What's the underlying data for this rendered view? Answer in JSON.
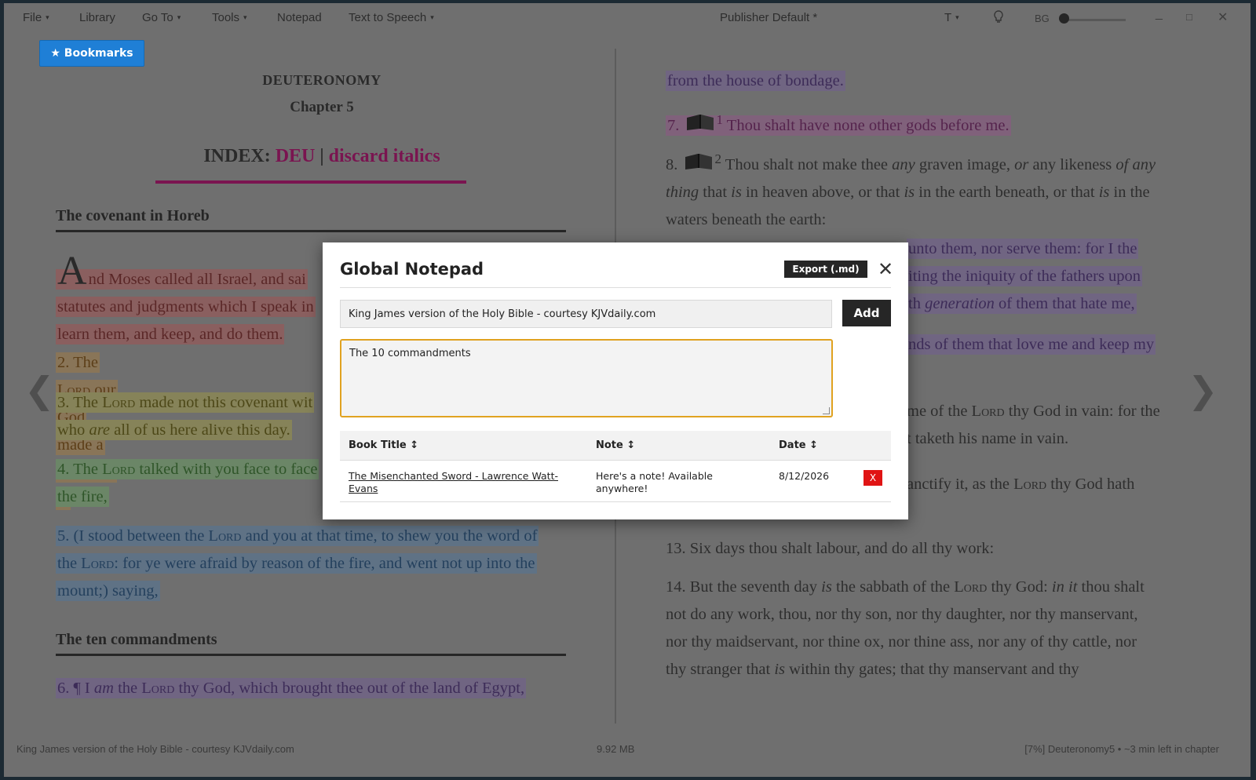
{
  "menu": {
    "file": "File",
    "library": "Library",
    "goto": "Go To",
    "tools": "Tools",
    "notepad": "Notepad",
    "tts": "Text to Speech",
    "caret": "▾"
  },
  "toolbar": {
    "publisher": "Publisher Default *",
    "font_button": "T",
    "bg_label": "BG",
    "minimize": "_",
    "maximize": "□",
    "close": "✕"
  },
  "bookmarks_label": "★ Bookmarks",
  "book": {
    "title": "DEUTERONOMY",
    "chapter": "Chapter 5",
    "index_prefix": "INDEX:",
    "index_deu": "DEU",
    "index_sep": " | ",
    "index_discard": "discard italics",
    "section1": "The covenant in Horeb",
    "section2": "The ten commandments",
    "accent_color": "#7a1450"
  },
  "left_verses": {
    "v1_cap": "A",
    "v1_rest": "nd Moses called all Israel, and sai",
    "v1_l2": "statutes and judgments which I speak in",
    "v1_l3": "learn them, and keep, and do them.",
    "v2_a": "2. The ",
    "v2_lord": "Lord",
    "v2_b": " our God made a covenant w",
    "v3_a": "3. The ",
    "v3_lord": "Lord",
    "v3_b": " made not this covenant wit",
    "v3_c": "who ",
    "v3_are": "are",
    "v3_d": " all of us here alive this day.",
    "v4_a": "4. The ",
    "v4_lord": "Lord",
    "v4_b": " talked with you face to face",
    "v4_c": "the fire,",
    "v5_a": "5. (I stood between the ",
    "v5_lord": "Lord",
    "v5_b": " and you at that time, to shew you the word of",
    "v5_c": "the ",
    "v5_lord2": "Lord",
    "v5_d": ": for ye were afraid by reason of the fire, and went not up into the",
    "v5_e": "mount;) saying,",
    "v6_a": "6. ¶ I ",
    "v6_am": "am",
    "v6_b": " the ",
    "v6_lord": "Lord",
    "v6_c": " thy God, which brought thee out of the land of Egypt,"
  },
  "right_verses": {
    "r0": "from the house of bondage.",
    "r7_num": "7.",
    "r7_sup": "1",
    "r7_text": " Thou shalt have none other gods before me.",
    "r8_num": "8.",
    "r8_sup": "2",
    "r8_a": " Thou shalt not make thee ",
    "r8_any": "any",
    "r8_b": " graven image, ",
    "r8_or": "or",
    "r8_c": " any likeness ",
    "r8_ofany": "of any",
    "r8_thing": "thing",
    "r8_d": " that ",
    "r8_is": "is",
    "r8_e": " in heaven above, or that ",
    "r8_is2": "is",
    "r8_f": " in the earth beneath, or that ",
    "r8_is3": "is",
    "r8_g": " in the",
    "r8_h": "waters beneath the earth:",
    "r9_a": "unto them, nor serve them: for I the",
    "r9_b": "iting the iniquity of the fathers upon",
    "r9_c": "th ",
    "r9_gen": "generation",
    "r9_d": " of them that hate me,",
    "r10": "nds of them that love me and keep my",
    "r11_a": "me of the ",
    "r11_lord": "Lord",
    "r11_b": " thy God in vain: for the",
    "r11_c": "t taketh his name in vain.",
    "r12_a": "anctify it, as the ",
    "r12_lord": "Lord",
    "r12_b": " thy God hath",
    "r13": "13. Six days thou shalt labour, and do all thy work:",
    "r14_a": "14. But the seventh day ",
    "r14_is": "is",
    "r14_b": " the sabbath of the ",
    "r14_lord": "Lord",
    "r14_c": " thy God: ",
    "r14_init": "in it",
    "r14_d": " thou shalt",
    "r14_l2": "not do any work, thou, nor thy son, nor thy daughter, nor thy manservant,",
    "r14_l3": "nor thy maidservant, nor thine ox, nor thine ass, nor any of thy cattle, nor",
    "r14_l4a": "thy stranger that ",
    "r14_is2": "is",
    "r14_l4b": " within thy gates; that thy manservant and thy"
  },
  "nav": {
    "prev": "❮",
    "next": "❯"
  },
  "status": {
    "left": "King James version of the Holy Bible - courtesy KJVdaily.com",
    "center": "9.92 MB",
    "right": "[7%] Deuteronomy5 • ~3 min left in chapter"
  },
  "notepad": {
    "title": "Global Notepad",
    "export_label": "Export (.md)",
    "close": "✕",
    "source_value": "King James version of the Holy Bible - courtesy KJVdaily.com",
    "add_label": "Add",
    "note_value": "The 10 commandments",
    "columns": [
      "Book Title ↕",
      "Note ↕",
      "Date ↕"
    ],
    "rows": [
      {
        "title_l1": "The Misenchanted Sword - Lawrence Watt-",
        "title_l2": "Evans",
        "note_l1": "Here's a note! Available",
        "note_l2": "anywhere!",
        "date": "8/12/2026",
        "delete": "X"
      }
    ]
  }
}
